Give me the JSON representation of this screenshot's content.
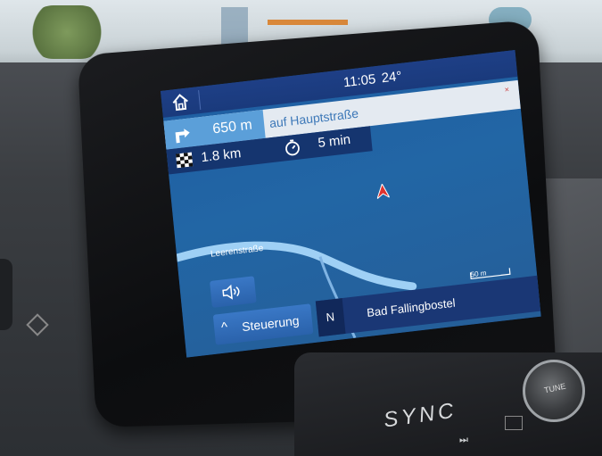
{
  "status_bar": {
    "time": "11:05",
    "temperature": "24°"
  },
  "navigation": {
    "next_turn_distance": "650 m",
    "next_turn_street": "auf Hauptstraße",
    "close_symbol": "×",
    "remaining_distance": "1.8 km",
    "remaining_time": "5 min",
    "current_street": "Leerenstraße",
    "map_scale": "50 m",
    "heading": "N",
    "destination": "Bad Fallingbostel"
  },
  "controls": {
    "audio_icon": "speaker-icon",
    "steering_chevron": "^",
    "steering_label": "Steuerung"
  },
  "hardware": {
    "brand": "SYNC",
    "knob_label": "TUNE",
    "media_symbol": "⏭",
    "eject_symbol": "⏏"
  },
  "colors": {
    "topbar": "#1e3f86",
    "map": "#1f5fa3",
    "turn_accent": "#5b9fd9",
    "street_text": "#3d78b8",
    "route_line": "#9fd0f5",
    "vehicle": "#e0322d"
  }
}
